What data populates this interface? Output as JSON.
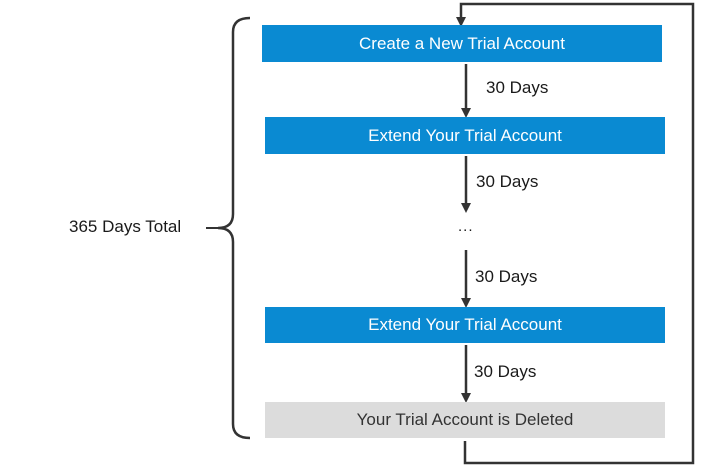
{
  "steps": {
    "create": "Create a New Trial Account",
    "extend_1": "Extend Your Trial Account",
    "extend_2": "Extend Your Trial Account",
    "deleted": "Your Trial Account is Deleted"
  },
  "intervals": {
    "first": "30 Days",
    "second": "30 Days",
    "third": "30 Days",
    "fourth": "30 Days"
  },
  "ellipsis": "...",
  "total_label": "365 Days Total",
  "colors": {
    "step": "#0a8ad2",
    "deleted": "#dcdcdc",
    "connector": "#333333"
  }
}
